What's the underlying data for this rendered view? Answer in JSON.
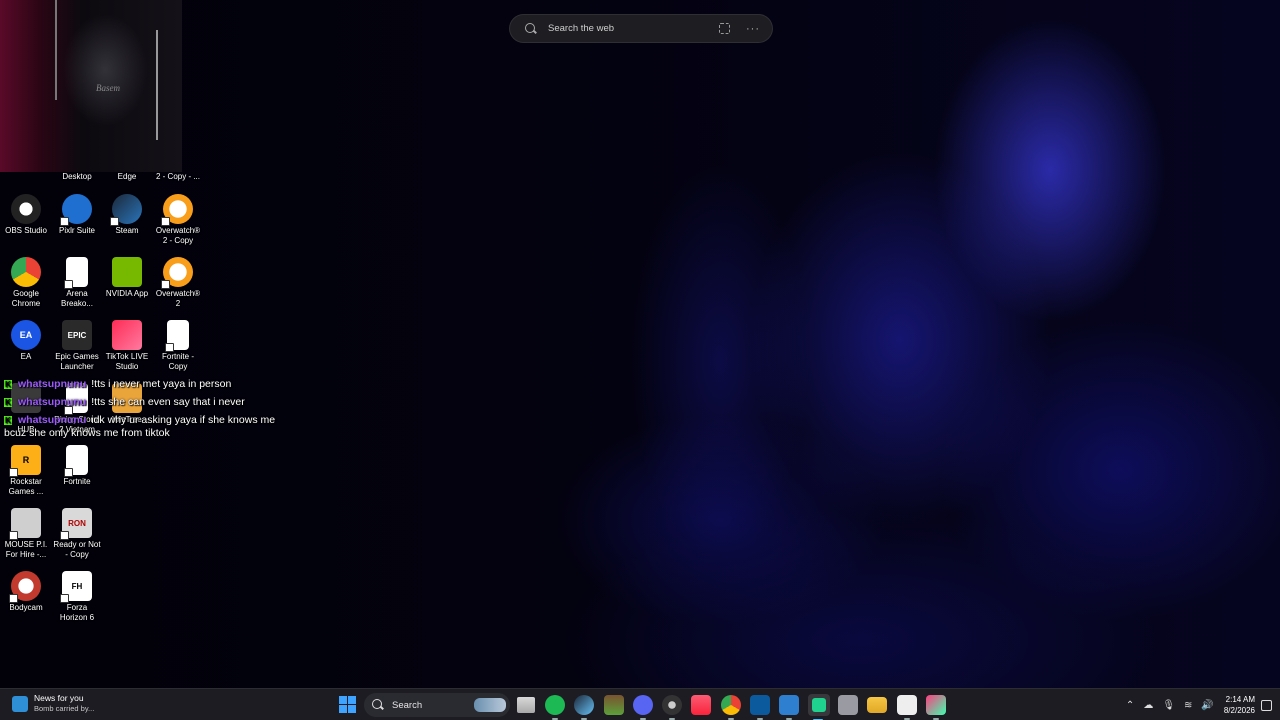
{
  "search_widget": {
    "placeholder": "Search the web",
    "more": "···"
  },
  "desktop": {
    "top_row": [
      "Desktop",
      "Edge",
      "2 - Copy - ..."
    ],
    "icons": [
      {
        "label": "OBS Studio",
        "icon": "obs-icon",
        "color": "#2b2b2b"
      },
      {
        "label": "Pixlr Suite",
        "icon": "pixlr-icon",
        "color": "#1f6fd1"
      },
      {
        "label": "Steam",
        "icon": "steam-icon",
        "color": "#1b2838"
      },
      {
        "label": "Overwatch® 2 - Copy",
        "icon": "overwatch-icon",
        "color": "#f99e1a"
      },
      {
        "label": "Google Chrome",
        "icon": "chrome-icon",
        "color": "#4285f4"
      },
      {
        "label": "Arena Breako...",
        "icon": "file-icon",
        "color": "#ffffff"
      },
      {
        "label": "NVIDIA App",
        "icon": "nvidia-icon",
        "color": "#76b900"
      },
      {
        "label": "Overwatch® 2",
        "icon": "overwatch-icon",
        "color": "#f99e1a"
      },
      {
        "label": "EA",
        "icon": "ea-icon",
        "color": "#1a55e3"
      },
      {
        "label": "Epic Games Launcher",
        "icon": "epic-icon",
        "color": "#2a2a2a"
      },
      {
        "label": "TikTok LIVE Studio",
        "icon": "tiktok-icon",
        "color": "#fe2c55"
      },
      {
        "label": "Fortnite - Copy",
        "icon": "file-icon",
        "color": "#ffffff"
      },
      {
        "label": "HUB",
        "icon": "hub-icon",
        "color": "#3a3a3a"
      },
      {
        "label": "Rising Storm 2 Vietnam",
        "icon": "file-icon",
        "color": "#ffffff"
      },
      {
        "label": "WizTree",
        "icon": "wiztree-icon",
        "color": "#e9a43a"
      },
      {
        "label": "Rockstar Games ...",
        "icon": "rockstar-icon",
        "color": "#fcaf17"
      },
      {
        "label": "Fortnite",
        "icon": "file-icon",
        "color": "#ffffff"
      },
      {
        "label": "MOUSE P.I. For Hire -...",
        "icon": "mouse-icon",
        "color": "#cfcfcf"
      },
      {
        "label": "Ready or Not - Copy",
        "icon": "ready-or-not-icon",
        "color": "#d9d9d9"
      },
      {
        "label": "Bodycam",
        "icon": "bodycam-icon",
        "color": "#c23a2e"
      },
      {
        "label": "Forza Horizon 6",
        "icon": "forza-icon",
        "color": "#ffffff"
      }
    ]
  },
  "chat": [
    {
      "badge": "K",
      "user": "whatsupnunu",
      "message": "!tts i never met yaya in person"
    },
    {
      "badge": "K",
      "user": "whatsupnunu",
      "message": "!tts she can even say that i never"
    },
    {
      "badge": "K",
      "user": "whatsupnunu",
      "message": "idk why ur asking yaya if she knows me bcuz she only knows me from tiktok"
    }
  ],
  "taskbar": {
    "news_title": "News for you",
    "news_subtitle": "Bomb carried by...",
    "search_label": "Search",
    "apps": [
      "start-icon",
      "task-view-icon",
      "spotify-icon",
      "steam-icon",
      "minecraft-icon",
      "discord-icon",
      "obs-icon",
      "itunes-icon",
      "chrome-icon",
      "window-icon",
      "notepad-icon",
      "app-icon",
      "gray-app-icon",
      "file-explorer-icon",
      "vs-code-icon",
      "capcut-icon"
    ],
    "time": "2:14 AM",
    "date": "8/2/2026"
  }
}
